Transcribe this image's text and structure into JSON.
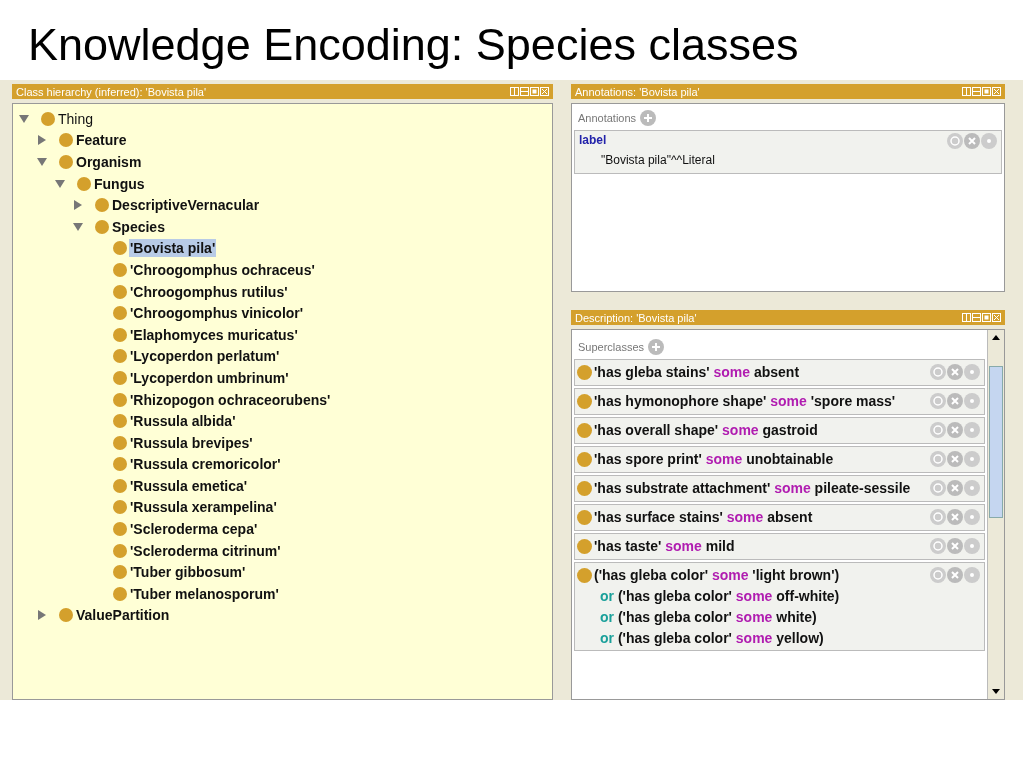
{
  "title": "Knowledge Encoding: Species classes",
  "hierarchy": {
    "title": "Class hierarchy (inferred): 'Bovista pila'",
    "tree": [
      {
        "label": "Thing",
        "expanded": true,
        "selected": false,
        "children": [
          {
            "label": "Feature",
            "expanded": false,
            "selected": false
          },
          {
            "label": "Organism",
            "expanded": true,
            "selected": false,
            "children": [
              {
                "label": "Fungus",
                "expanded": true,
                "selected": false,
                "children": [
                  {
                    "label": "DescriptiveVernacular",
                    "expanded": false,
                    "selected": false
                  },
                  {
                    "label": "Species",
                    "expanded": true,
                    "selected": false,
                    "children": [
                      {
                        "label": "'Bovista pila'",
                        "selected": true
                      },
                      {
                        "label": "'Chroogomphus ochraceus'",
                        "selected": false
                      },
                      {
                        "label": "'Chroogomphus rutilus'",
                        "selected": false
                      },
                      {
                        "label": "'Chroogomphus vinicolor'",
                        "selected": false
                      },
                      {
                        "label": "'Elaphomyces muricatus'",
                        "selected": false
                      },
                      {
                        "label": "'Lycoperdon perlatum'",
                        "selected": false
                      },
                      {
                        "label": "'Lycoperdon umbrinum'",
                        "selected": false
                      },
                      {
                        "label": "'Rhizopogon ochraceorubens'",
                        "selected": false
                      },
                      {
                        "label": "'Russula albida'",
                        "selected": false
                      },
                      {
                        "label": "'Russula brevipes'",
                        "selected": false
                      },
                      {
                        "label": "'Russula cremoricolor'",
                        "selected": false
                      },
                      {
                        "label": "'Russula emetica'",
                        "selected": false
                      },
                      {
                        "label": "'Russula xerampelina'",
                        "selected": false
                      },
                      {
                        "label": "'Scleroderma cepa'",
                        "selected": false
                      },
                      {
                        "label": "'Scleroderma citrinum'",
                        "selected": false
                      },
                      {
                        "label": "'Tuber gibbosum'",
                        "selected": false
                      },
                      {
                        "label": "'Tuber melanosporum'",
                        "selected": false
                      }
                    ]
                  }
                ]
              }
            ]
          },
          {
            "label": "ValuePartition",
            "expanded": false,
            "selected": false
          }
        ]
      }
    ]
  },
  "annotations": {
    "title": "Annotations: 'Bovista pila'",
    "section": "Annotations",
    "items": [
      {
        "property": "label",
        "value": "\"Bovista pila\"^^Literal"
      }
    ]
  },
  "description": {
    "title": "Description: 'Bovista pila'",
    "section": "Superclasses",
    "items": [
      {
        "lines": [
          [
            {
              "text": "'has gleba stains' ",
              "kind": "plain"
            },
            {
              "text": "some",
              "kind": "keyword"
            },
            {
              "text": " absent",
              "kind": "plain"
            }
          ]
        ]
      },
      {
        "lines": [
          [
            {
              "text": "'has hymonophore shape' ",
              "kind": "plain"
            },
            {
              "text": "some",
              "kind": "keyword"
            },
            {
              "text": " 'spore mass'",
              "kind": "plain"
            }
          ]
        ]
      },
      {
        "lines": [
          [
            {
              "text": "'has overall shape' ",
              "kind": "plain"
            },
            {
              "text": "some",
              "kind": "keyword"
            },
            {
              "text": " gastroid",
              "kind": "plain"
            }
          ]
        ]
      },
      {
        "lines": [
          [
            {
              "text": "'has spore print' ",
              "kind": "plain"
            },
            {
              "text": "some",
              "kind": "keyword"
            },
            {
              "text": " unobtainable",
              "kind": "plain"
            }
          ]
        ]
      },
      {
        "lines": [
          [
            {
              "text": "'has substrate attachment' ",
              "kind": "plain"
            },
            {
              "text": "some",
              "kind": "keyword"
            },
            {
              "text": " pileate-sessile",
              "kind": "plain"
            }
          ]
        ]
      },
      {
        "lines": [
          [
            {
              "text": "'has surface stains' ",
              "kind": "plain"
            },
            {
              "text": "some",
              "kind": "keyword"
            },
            {
              "text": " absent",
              "kind": "plain"
            }
          ]
        ]
      },
      {
        "lines": [
          [
            {
              "text": "'has taste' ",
              "kind": "plain"
            },
            {
              "text": "some",
              "kind": "keyword"
            },
            {
              "text": " mild",
              "kind": "plain"
            }
          ]
        ]
      },
      {
        "lines": [
          [
            {
              "text": "('has gleba color' ",
              "kind": "plain"
            },
            {
              "text": "some",
              "kind": "keyword"
            },
            {
              "text": " 'light brown')",
              "kind": "plain"
            }
          ],
          [
            {
              "text": "or",
              "kind": "operator"
            },
            {
              "text": " ('has gleba color' ",
              "kind": "plain"
            },
            {
              "text": "some",
              "kind": "keyword"
            },
            {
              "text": " off-white)",
              "kind": "plain"
            }
          ],
          [
            {
              "text": "or",
              "kind": "operator"
            },
            {
              "text": " ('has gleba color' ",
              "kind": "plain"
            },
            {
              "text": "some",
              "kind": "keyword"
            },
            {
              "text": " white)",
              "kind": "plain"
            }
          ],
          [
            {
              "text": "or",
              "kind": "operator"
            },
            {
              "text": " ('has gleba color' ",
              "kind": "plain"
            },
            {
              "text": "some",
              "kind": "keyword"
            },
            {
              "text": " yellow)",
              "kind": "plain"
            }
          ]
        ]
      }
    ]
  }
}
